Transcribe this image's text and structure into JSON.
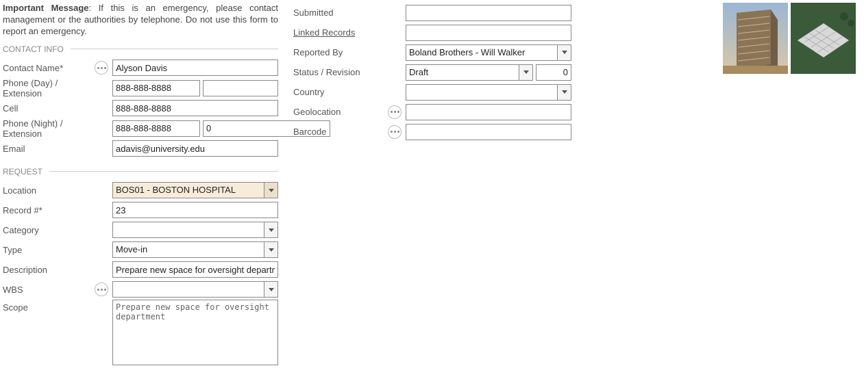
{
  "important_msg": {
    "label": "Important Message",
    "text": ": If this is an emergency, please contact management or the authorities by telephone. Do not use this form to report an emergency."
  },
  "sections": {
    "contact": "CONTACT INFO",
    "request": "REQUEST"
  },
  "labels": {
    "contact_name": "Contact Name*",
    "phone_day": "Phone (Day) / Extension",
    "cell": "Cell",
    "phone_night": "Phone (Night) / Extension",
    "email": "Email",
    "location": "Location",
    "record_no": "Record #*",
    "category": "Category",
    "type": "Type",
    "description": "Description",
    "wbs": "WBS",
    "scope": "Scope",
    "submitted": "Submitted",
    "linked_records": "Linked Records",
    "reported_by": "Reported By",
    "status_revision": "Status / Revision",
    "country": "Country",
    "geolocation": "Geolocation",
    "barcode": "Barcode"
  },
  "values": {
    "contact_name": "Alyson Davis",
    "phone_day": "888-888-8888",
    "phone_day_ext": "",
    "cell": "888-888-8888",
    "phone_night": "888-888-8888",
    "phone_night_ext": "0",
    "email": "adavis@university.edu",
    "location": "BOS01 - BOSTON HOSPITAL",
    "record_no": "23",
    "category": "",
    "type": "Move-in",
    "description": "Prepare new space for oversight department",
    "wbs": "",
    "scope": "Prepare new space for oversight department",
    "submitted": "",
    "linked_records": "",
    "reported_by": "Boland Brothers - Will Walker",
    "status": "Draft",
    "revision": "0",
    "country": "",
    "geolocation": "",
    "barcode": ""
  }
}
